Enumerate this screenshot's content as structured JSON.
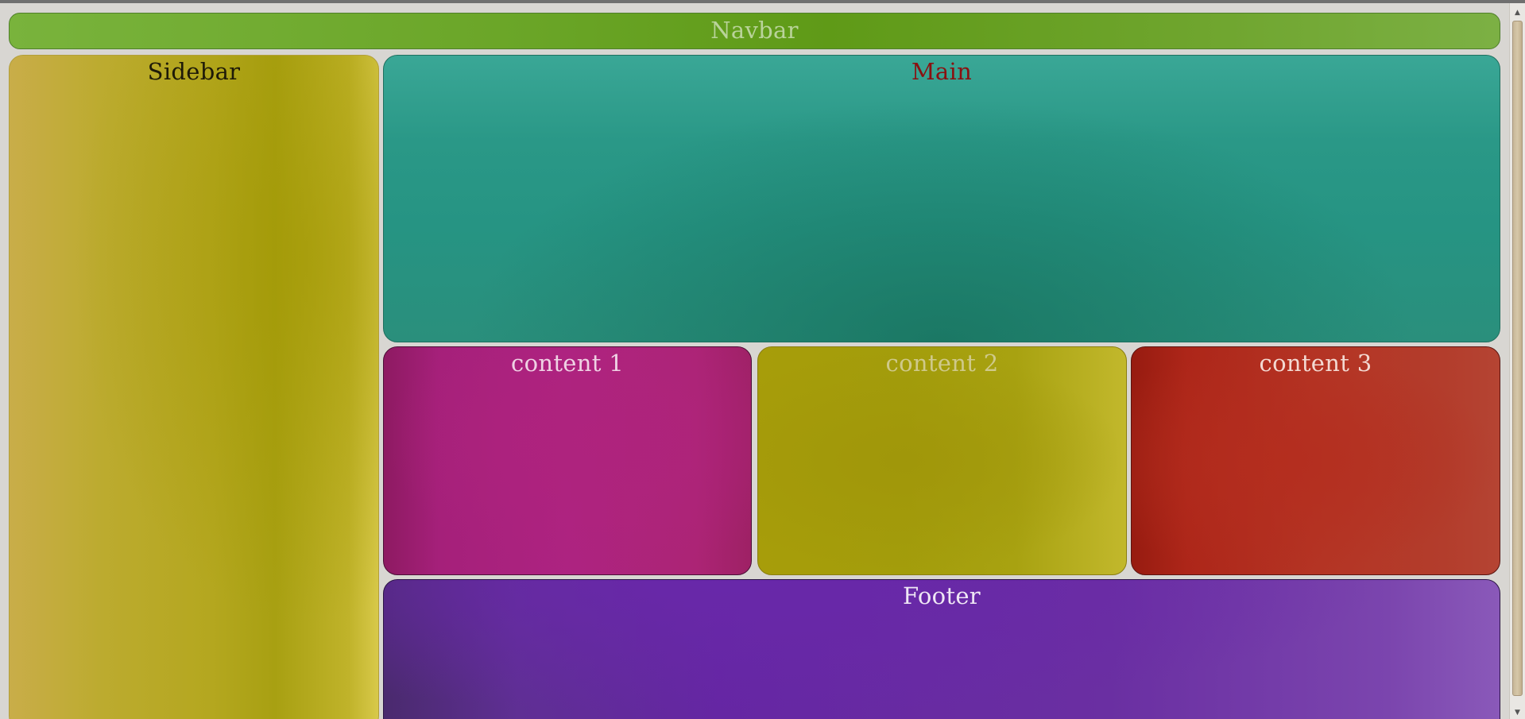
{
  "layout": {
    "navbar": {
      "label": "Navbar",
      "text_color": "#b9d39a",
      "bg": "#6aa527"
    },
    "sidebar": {
      "label": "Sidebar",
      "text_color": "#1e1a08",
      "bg": "#b4a71f"
    },
    "main": {
      "label": "Main",
      "text_color": "#8a1010",
      "bg": "#2a9887"
    },
    "content": [
      {
        "label": "content 1",
        "text_color": "#efd2e4",
        "bg": "#ad2381"
      },
      {
        "label": "content 2",
        "text_color": "#cfc98a",
        "bg": "#a39d0b"
      },
      {
        "label": "content 3",
        "text_color": "#f3d9d2",
        "bg": "#b43424"
      }
    ],
    "footer": {
      "label": "Footer",
      "text_color": "#efe7f5",
      "bg": "#6526a3"
    }
  },
  "scrollbar": {
    "up_icon": "scroll-up-arrow-icon",
    "down_icon": "scroll-down-arrow-icon"
  }
}
